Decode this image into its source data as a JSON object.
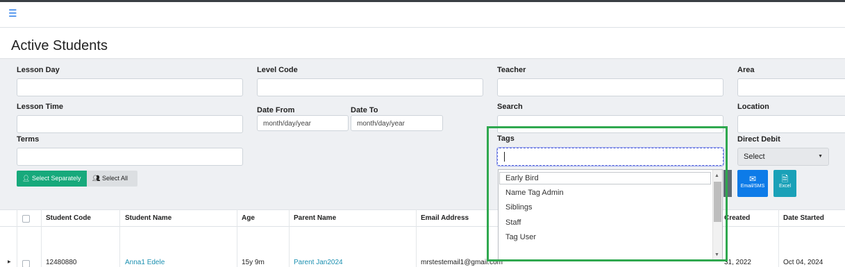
{
  "page": {
    "title": "Active Students"
  },
  "filters": {
    "lesson_day_label": "Lesson Day",
    "level_code_label": "Level Code",
    "teacher_label": "Teacher",
    "area_label": "Area",
    "lesson_time_label": "Lesson Time",
    "date_from_label": "Date From",
    "date_to_label": "Date To",
    "date_placeholder": "month/day/year",
    "search_label": "Search",
    "location_label": "Location",
    "terms_label": "Terms",
    "tags_label": "Tags",
    "direct_debit_label": "Direct Debit",
    "direct_debit_value": "Select"
  },
  "buttons": {
    "select_separately": "Select Separately",
    "select_all": "Select All",
    "email_sms": "Email/SMS",
    "excel": "Excel"
  },
  "tags_dropdown": {
    "options": [
      "Early Bird",
      "Name Tag Admin",
      "Siblings",
      "Staff",
      "Tag User"
    ]
  },
  "table": {
    "columns": [
      "Student Code",
      "Student Name",
      "Age",
      "Parent Name",
      "Email Address",
      "Created",
      "Date Started"
    ],
    "rows": [
      {
        "student_code": "12480880",
        "student_name": "Anna1 Edele",
        "age": "15y 9m",
        "parent_name": "Parent Jan2024",
        "email": "mrstestemail1@gmail.com",
        "created": "31, 2022",
        "date_started": "Oct 04, 2024"
      }
    ]
  },
  "colors": {
    "accent_green": "#17a97b",
    "email_blue": "#0d7be8",
    "excel_teal": "#1aa1b8",
    "link": "#1a8fb0",
    "highlight": "#2fa84f"
  }
}
